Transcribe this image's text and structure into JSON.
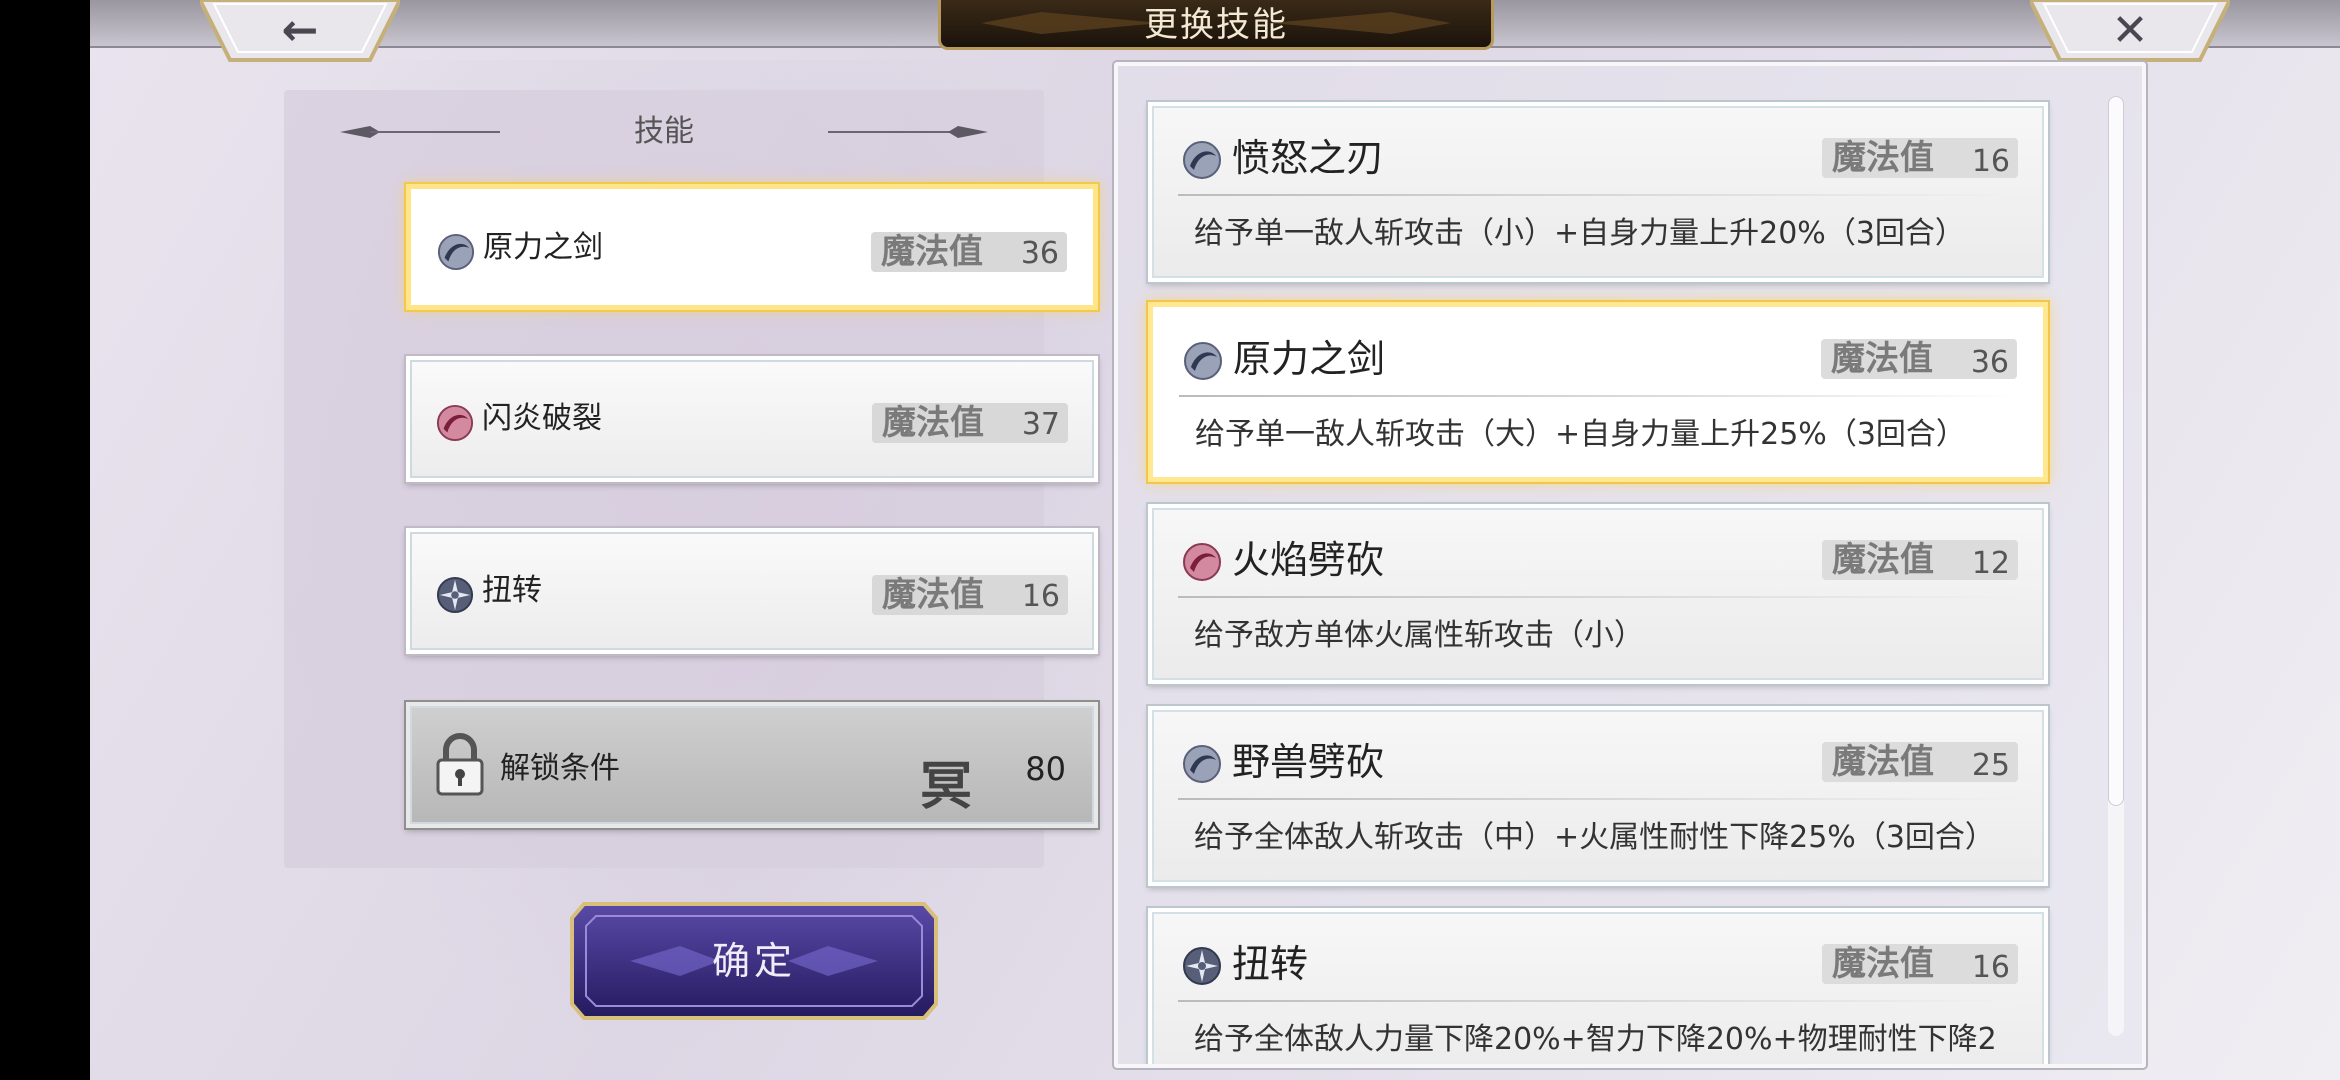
{
  "header": {
    "title": "更换技能",
    "back_icon": "←",
    "close_icon": "✕"
  },
  "left_panel": {
    "title": "技能",
    "slots": [
      {
        "name": "原力之剑",
        "cost_label": "魔法值",
        "cost": "36",
        "orb": "blue-orb-icon",
        "selected": true
      },
      {
        "name": "闪炎破裂",
        "cost_label": "魔法值",
        "cost": "37",
        "orb": "red-orb-icon",
        "selected": false
      },
      {
        "name": "扭转",
        "cost_label": "魔法值",
        "cost": "16",
        "orb": "star-orb-icon",
        "selected": false
      }
    ],
    "locked_slot": {
      "name": "解锁条件",
      "rank_glyph": "冥",
      "value": "80"
    }
  },
  "confirm_button": {
    "label": "确定"
  },
  "skill_list": [
    {
      "name": "愤怒之刃",
      "cost_label": "魔法值",
      "cost": "16",
      "desc": "给予单一敌人斩攻击（小）+自身力量上升20%（3回合）",
      "orb": "blue-orb-icon",
      "selected": false
    },
    {
      "name": "原力之剑",
      "cost_label": "魔法值",
      "cost": "36",
      "desc": "给予单一敌人斩攻击（大）+自身力量上升25%（3回合）",
      "orb": "blue-orb-icon",
      "selected": true
    },
    {
      "name": "火焰劈砍",
      "cost_label": "魔法值",
      "cost": "12",
      "desc": "给予敌方单体火属性斩攻击（小）",
      "orb": "red-orb-icon",
      "selected": false
    },
    {
      "name": "野兽劈砍",
      "cost_label": "魔法值",
      "cost": "25",
      "desc": "给予全体敌人斩攻击（中）+火属性耐性下降25%（3回合）",
      "orb": "blue-orb-icon",
      "selected": false
    },
    {
      "name": "扭转",
      "cost_label": "魔法值",
      "cost": "16",
      "desc": "给予全体敌人力量下降20%+智力下降20%+物理耐性下降2",
      "orb": "star-orb-icon",
      "selected": false
    }
  ],
  "colors": {
    "highlight": "#ffe58a",
    "orb_blue": "#3d4a6a",
    "orb_red": "#a8344f",
    "title_plate": "#2a1d10"
  }
}
